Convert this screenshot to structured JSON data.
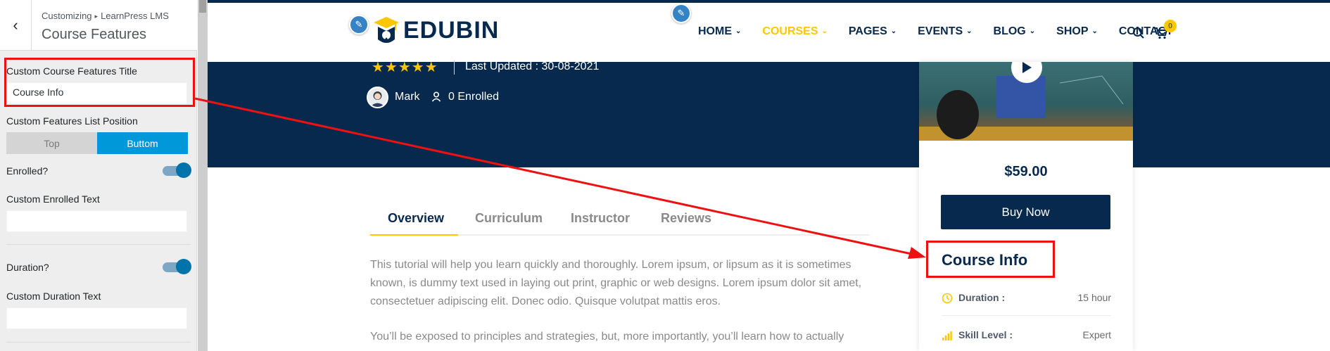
{
  "customizer": {
    "breadcrumb_root": "Customizing",
    "breadcrumb_section": "LearnPress LMS",
    "panel_title": "Course Features",
    "fields": {
      "features_title_label": "Custom Course Features Title",
      "features_title_value": "Course Info",
      "list_position_label": "Custom Features List Position",
      "position_top": "Top",
      "position_bottom": "Buttom",
      "position_selected": "Buttom",
      "enrolled_label": "Enrolled?",
      "enrolled_toggle": true,
      "enrolled_text_label": "Custom Enrolled Text",
      "enrolled_text_value": "",
      "duration_label": "Duration?",
      "duration_toggle": true,
      "duration_text_label": "Custom Duration Text",
      "duration_text_value": ""
    }
  },
  "site": {
    "logo_text": "EDUBIN",
    "nav": [
      {
        "label": "HOME",
        "dropdown": true
      },
      {
        "label": "COURSES",
        "dropdown": true,
        "active": true
      },
      {
        "label": "PAGES",
        "dropdown": true
      },
      {
        "label": "EVENTS",
        "dropdown": true
      },
      {
        "label": "BLOG",
        "dropdown": true
      },
      {
        "label": "SHOP",
        "dropdown": true
      },
      {
        "label": "CONTACT",
        "dropdown": false
      }
    ],
    "cart_count": "0",
    "colors": {
      "navy": "#07294d",
      "accent": "#ffc600",
      "highlight": "#ee1111"
    }
  },
  "course": {
    "rating_stars": "★★★★★",
    "last_updated": "Last Updated : 30-08-2021",
    "author": "Mark",
    "enrolled": "0 Enrolled",
    "tabs": [
      "Overview",
      "Curriculum",
      "Instructor",
      "Reviews"
    ],
    "active_tab": "Overview",
    "paragraph_1": "This tutorial will help you learn quickly and thoroughly. Lorem ipsum, or lipsum as it is sometimes known, is dummy text used in laying out print, graphic or web designs. Lorem ipsum dolor sit amet, consectetuer adipiscing elit. Donec odio. Quisque volutpat mattis eros.",
    "paragraph_2": "You’ll be exposed to principles and strategies, but, more importantly, you’ll learn how to actually",
    "price": "$59.00",
    "buy_label": "Buy Now",
    "info_title": "Course Info",
    "features": [
      {
        "label": "Duration :",
        "value": "15 hour",
        "icon": "clock-icon"
      },
      {
        "label": "Skill Level :",
        "value": "Expert",
        "icon": "signal-icon"
      }
    ]
  }
}
